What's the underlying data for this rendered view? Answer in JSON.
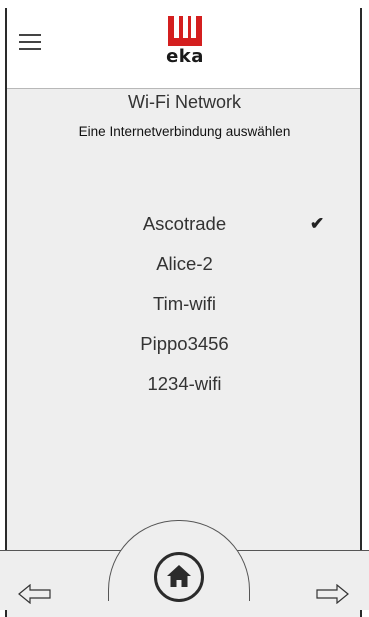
{
  "header": {
    "brand": "eka",
    "brand_color": "#d41f1f",
    "menu_icon": "hamburger-menu-icon"
  },
  "wifi": {
    "title": "Wi-Fi Network",
    "subtitle": "Eine Internetverbindung auswählen",
    "networks": [
      {
        "name": "Ascotrade",
        "selected": true
      },
      {
        "name": "Alice-2",
        "selected": false
      },
      {
        "name": "Tim-wifi",
        "selected": false
      },
      {
        "name": "Pippo3456",
        "selected": false
      },
      {
        "name": "1234-wifi",
        "selected": false
      }
    ],
    "selected_mark": "✔"
  },
  "footer": {
    "left_icon": "arrow-left-icon",
    "home_icon": "home-icon",
    "right_icon": "arrow-right-icon"
  }
}
